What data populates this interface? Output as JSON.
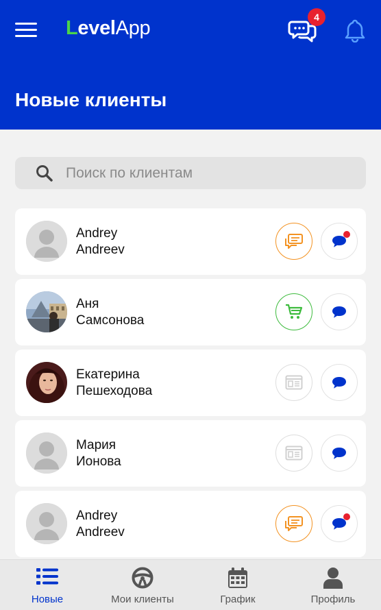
{
  "header": {
    "logo_part1": "L",
    "logo_part2": "evel",
    "logo_part3": "App",
    "notification_count": "4",
    "title": "Новые клиенты",
    "bg_color": "#0033cc"
  },
  "search": {
    "placeholder": "Поиск по клиентам",
    "value": ""
  },
  "clients": [
    {
      "first_name": "Andrey",
      "last_name": "Andreev",
      "avatar": "placeholder",
      "action_icon": "chat-bubbles-icon",
      "action_color": "orange",
      "has_unread": true
    },
    {
      "first_name": "Аня",
      "last_name": "Самсонова",
      "avatar": "photo-city",
      "action_icon": "cart-icon",
      "action_color": "green",
      "has_unread": false
    },
    {
      "first_name": "Екатерина",
      "last_name": "Пешеходова",
      "avatar": "photo-woman",
      "action_icon": "document-icon",
      "action_color": "gray",
      "has_unread": false
    },
    {
      "first_name": "Мария",
      "last_name": "Ионова",
      "avatar": "placeholder",
      "action_icon": "document-icon",
      "action_color": "gray",
      "has_unread": false
    },
    {
      "first_name": "Andrey",
      "last_name": "Andreev",
      "avatar": "placeholder",
      "action_icon": "chat-bubbles-icon",
      "action_color": "orange",
      "has_unread": true
    }
  ],
  "bottom_nav": [
    {
      "label": "Новые",
      "icon": "list-icon",
      "active": true
    },
    {
      "label": "Мои клиенты",
      "icon": "steering-wheel-icon",
      "active": false
    },
    {
      "label": "График",
      "icon": "calendar-icon",
      "active": false
    },
    {
      "label": "Профиль",
      "icon": "person-icon",
      "active": false
    }
  ],
  "colors": {
    "primary": "#0033cc",
    "orange": "#f39221",
    "green": "#3dbb3d",
    "badge_red": "#e8212e"
  }
}
